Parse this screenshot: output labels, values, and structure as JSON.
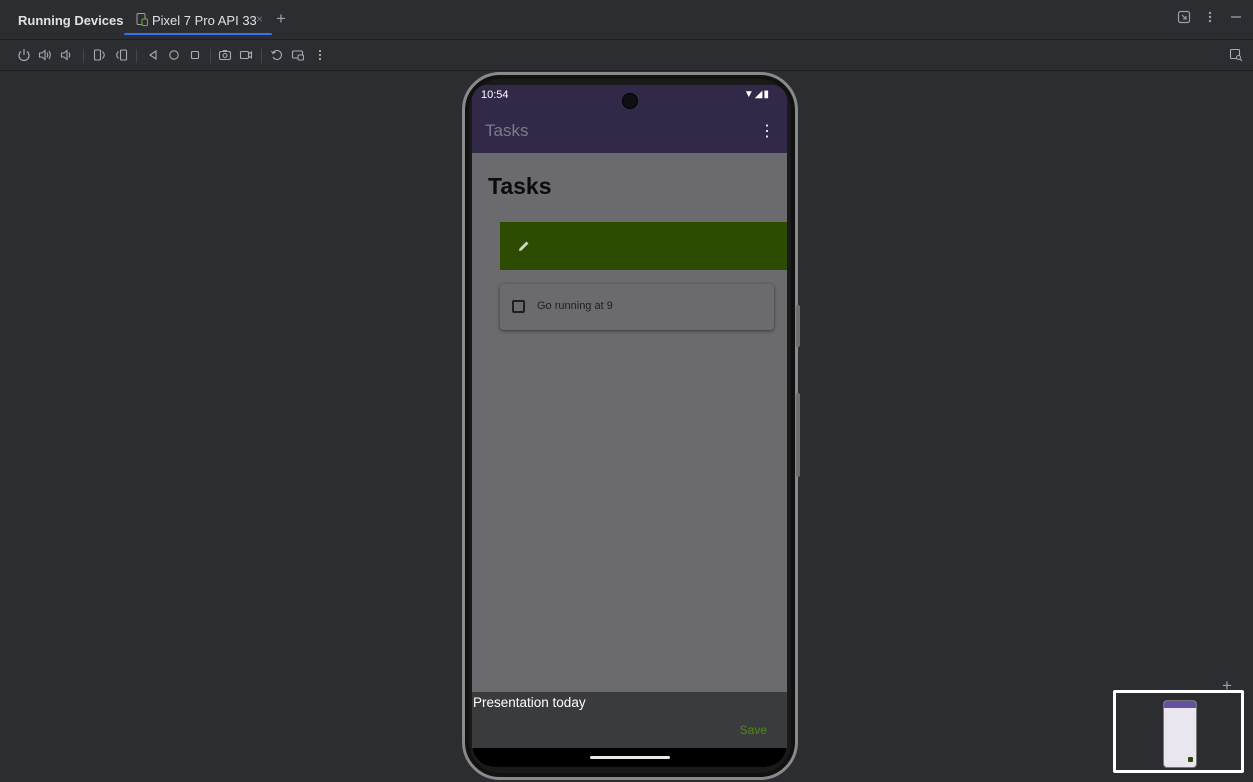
{
  "panel": {
    "title": "Running Devices"
  },
  "tabs": [
    {
      "label": "Pixel 7 Pro API 33",
      "close": "×",
      "active": true
    }
  ],
  "add_tab": "+",
  "window_icons": [
    "device-manager-icon",
    "more-options-icon",
    "minimize-icon"
  ],
  "toolbar": {
    "icons": [
      "power-icon",
      "volume-up-icon",
      "volume-down-icon",
      "rotate-left-icon",
      "rotate-right-icon",
      "back-icon",
      "home-icon",
      "overview-icon",
      "screenshot-icon",
      "screen-record-icon",
      "snapshot-icon",
      "extended-controls-icon",
      "more-options-icon"
    ],
    "right_icon": "inspect-icon"
  },
  "device": {
    "status": {
      "time": "10:54",
      "icons": "▼◢▮"
    },
    "app_bar": {
      "title": "Tasks",
      "menu": "⋮"
    },
    "content": {
      "heading": "Tasks",
      "tasks": [
        {
          "label": "Go running at 9",
          "checked": false
        }
      ]
    },
    "bottom_sheet": {
      "input_value": "Presentation today",
      "save_label": "Save"
    }
  },
  "minimap": {
    "plus": "+"
  },
  "colors": {
    "accent": "#3574f0",
    "app_bar": "#322847",
    "swipe_bg": "#2d4c01",
    "save_text": "#4f8a10"
  }
}
